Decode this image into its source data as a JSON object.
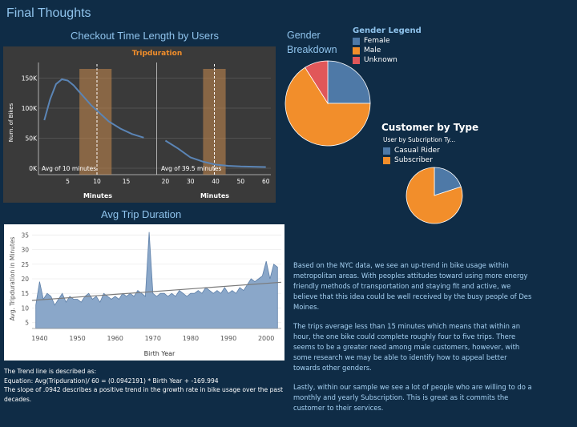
{
  "page": {
    "title": "Final Thoughts"
  },
  "colors": {
    "background": "#0f2c46",
    "accent_text": "#8fc3ec",
    "female": "#4e79a7",
    "male": "#f28e2b",
    "unknown": "#e15759",
    "line": "#5b85b6",
    "band": "#c98a4e",
    "panel": "#3a3a3a"
  },
  "chart_data": [
    {
      "type": "line",
      "title": "Checkout Time Length by Users",
      "subtitle": "Tripduration",
      "xlabel": "Minutes",
      "ylabel": "Num. of Bikes",
      "y_ticks": [
        "150K",
        "100K",
        "50K",
        "0K"
      ],
      "ylim": [
        0,
        160000
      ],
      "panels": [
        {
          "x_ticks": [
            5,
            10,
            15
          ],
          "xlim": [
            0,
            20
          ],
          "x": [
            1,
            2,
            3,
            4,
            5,
            6,
            7,
            8,
            9,
            10,
            12,
            14,
            16,
            18
          ],
          "y": [
            80000,
            115000,
            140000,
            148000,
            146000,
            138000,
            127000,
            116000,
            105000,
            96000,
            78000,
            66000,
            57000,
            51000
          ],
          "highlight_range": [
            7,
            12.5
          ],
          "avg_line": 10,
          "annotation": "Avg of 10 minutes"
        },
        {
          "x_ticks": [
            20,
            30,
            40,
            50,
            60
          ],
          "xlim": [
            17,
            62
          ],
          "x": [
            20,
            25,
            30,
            35,
            40,
            45,
            50,
            55,
            60
          ],
          "y": [
            46000,
            33000,
            18000,
            11000,
            6000,
            4000,
            3000,
            2500,
            2000
          ],
          "highlight_range": [
            35,
            44
          ],
          "avg_line": 39.5,
          "annotation": "Avg of 39.5 minutes"
        }
      ]
    },
    {
      "type": "pie",
      "title": "Gender Breakdown",
      "legend_title": "Gender Legend",
      "legend": [
        "Female",
        "Male",
        "Unknown"
      ],
      "values": [
        25,
        66,
        9
      ]
    },
    {
      "type": "pie",
      "title": "Customer by Type",
      "legend_title": "User by Subcription Ty...",
      "legend": [
        "Casual Rider",
        "Subscriber"
      ],
      "values": [
        20,
        80
      ]
    },
    {
      "type": "area",
      "title": "Avg Trip Duration",
      "xlabel": "Birth Year",
      "ylabel": "Avg. Tripduration in Minutes",
      "x_ticks": [
        1940,
        1950,
        1960,
        1970,
        1980,
        1990,
        2000
      ],
      "y_ticks": [
        5,
        10,
        15,
        20,
        25,
        30,
        35
      ],
      "xlim": [
        1938,
        2004
      ],
      "ylim": [
        3,
        37
      ],
      "x": [
        1939,
        1940,
        1941,
        1942,
        1943,
        1944,
        1945,
        1946,
        1947,
        1948,
        1949,
        1950,
        1951,
        1952,
        1953,
        1954,
        1955,
        1956,
        1957,
        1958,
        1959,
        1960,
        1961,
        1962,
        1963,
        1964,
        1965,
        1966,
        1967,
        1968,
        1969,
        1970,
        1971,
        1972,
        1973,
        1974,
        1975,
        1976,
        1977,
        1978,
        1979,
        1980,
        1981,
        1982,
        1983,
        1984,
        1985,
        1986,
        1987,
        1988,
        1989,
        1990,
        1991,
        1992,
        1993,
        1994,
        1995,
        1996,
        1997,
        1998,
        1999,
        2000,
        2001,
        2002,
        2003
      ],
      "y": [
        11,
        19,
        13,
        15,
        14,
        11,
        13,
        15,
        12,
        14,
        13,
        13,
        12,
        14,
        15,
        13,
        14,
        12,
        15,
        14,
        13,
        14,
        13,
        15,
        14,
        15,
        14,
        16,
        15,
        14,
        36,
        15,
        14,
        15,
        15,
        14,
        15,
        14,
        16,
        15,
        14,
        15,
        15,
        16,
        15,
        17,
        16,
        15,
        16,
        15,
        17,
        15,
        16,
        15,
        17,
        16,
        18,
        20,
        19,
        20,
        21,
        26,
        20,
        25,
        24
      ],
      "trend": {
        "slope": 0.0942191,
        "intercept": -169.994
      }
    }
  ],
  "trend_note": {
    "heading": "The Trend line is described as:",
    "equation": "Equation: Avg(Tripduration)/ 60 = (0.0942191) * Birth Year + -169.994",
    "slope_text": "The slope of .0942 describes a positive trend in the growth rate in bike usage over the past decades."
  },
  "paragraphs": [
    "Based on the NYC data, we see an up-trend in bike usage within metropolitan areas. With peoples attitudes toward using more energy friendly methods of transportation and staying fit and active, we believe that this idea could be well received by the busy people of Des Moines.",
    "The trips average less than 15 minutes which means that within an hour, the one bike could complete roughly four to five trips. There seems to be a greater need among male customers, however, with some research we may be able to identify how to appeal better towards other genders.",
    "Lastly, within our sample we see a lot of people who are willing to do a monthly and yearly Subscription. This is great as it commits the customer to their services."
  ]
}
